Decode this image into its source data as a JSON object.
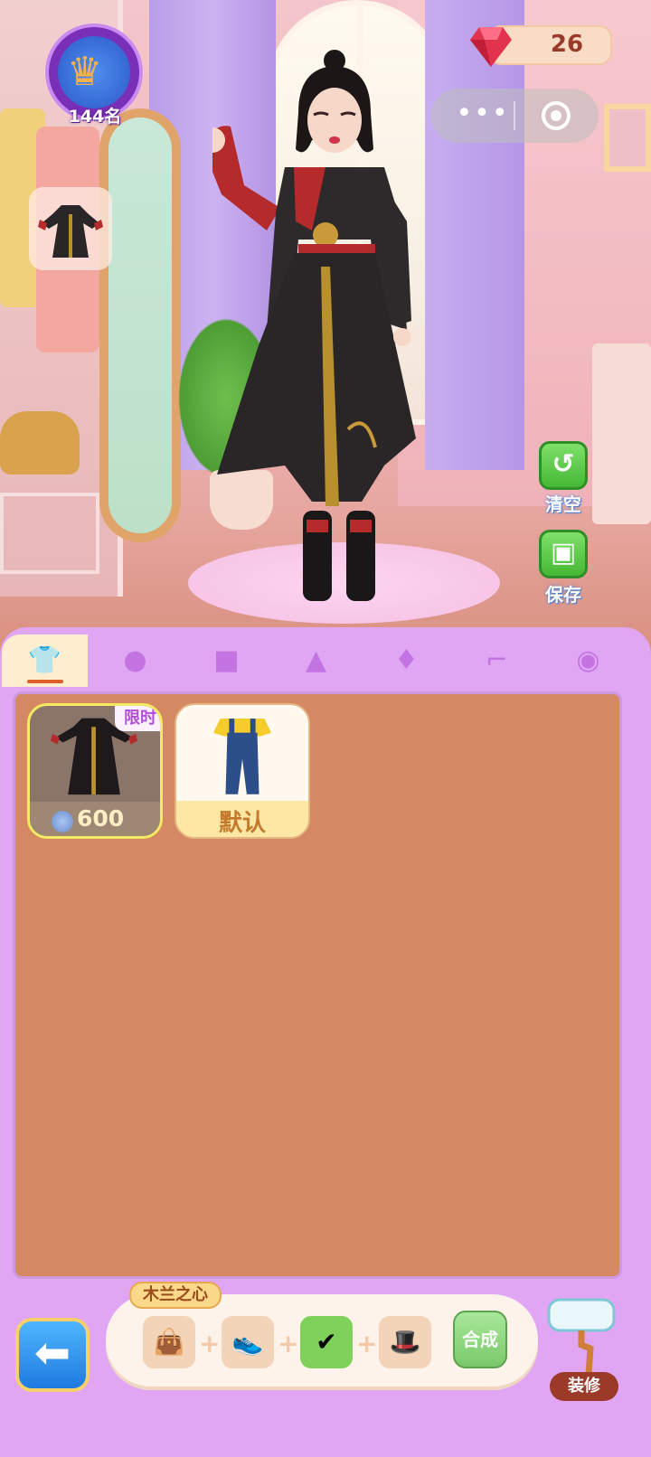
{
  "hud": {
    "rank_label": "144名",
    "gems": "26"
  },
  "side_actions": {
    "clear_label": "清空",
    "save_label": "保存"
  },
  "tabs": [
    {
      "icon": "outfit-set-icon",
      "active": true
    },
    {
      "icon": "hair-icon",
      "active": false
    },
    {
      "icon": "top-icon",
      "active": false
    },
    {
      "icon": "skirt-icon",
      "active": false
    },
    {
      "icon": "dress-icon",
      "active": false
    },
    {
      "icon": "high-heel-icon",
      "active": false
    },
    {
      "icon": "accessory-icon",
      "active": false
    }
  ],
  "items": [
    {
      "badge": "限时",
      "price": "600",
      "currency_icon": "clothing-coin-icon",
      "selected": true
    },
    {
      "label": "默认",
      "selected": false
    }
  ],
  "combo": {
    "title": "木兰之心",
    "synth_label": "合成",
    "slots": [
      {
        "icon": "handbag-icon",
        "checked": false
      },
      {
        "icon": "shoes-icon",
        "checked": false
      },
      {
        "icon": "gift-box-icon",
        "checked": true
      },
      {
        "icon": "hat-icon",
        "checked": false
      }
    ]
  },
  "decor_label": "装修",
  "colors": {
    "panel": "#e0a6f4",
    "content": "#d48963",
    "accent_green": "#45b834",
    "accent_blue": "#1f7ae0"
  }
}
